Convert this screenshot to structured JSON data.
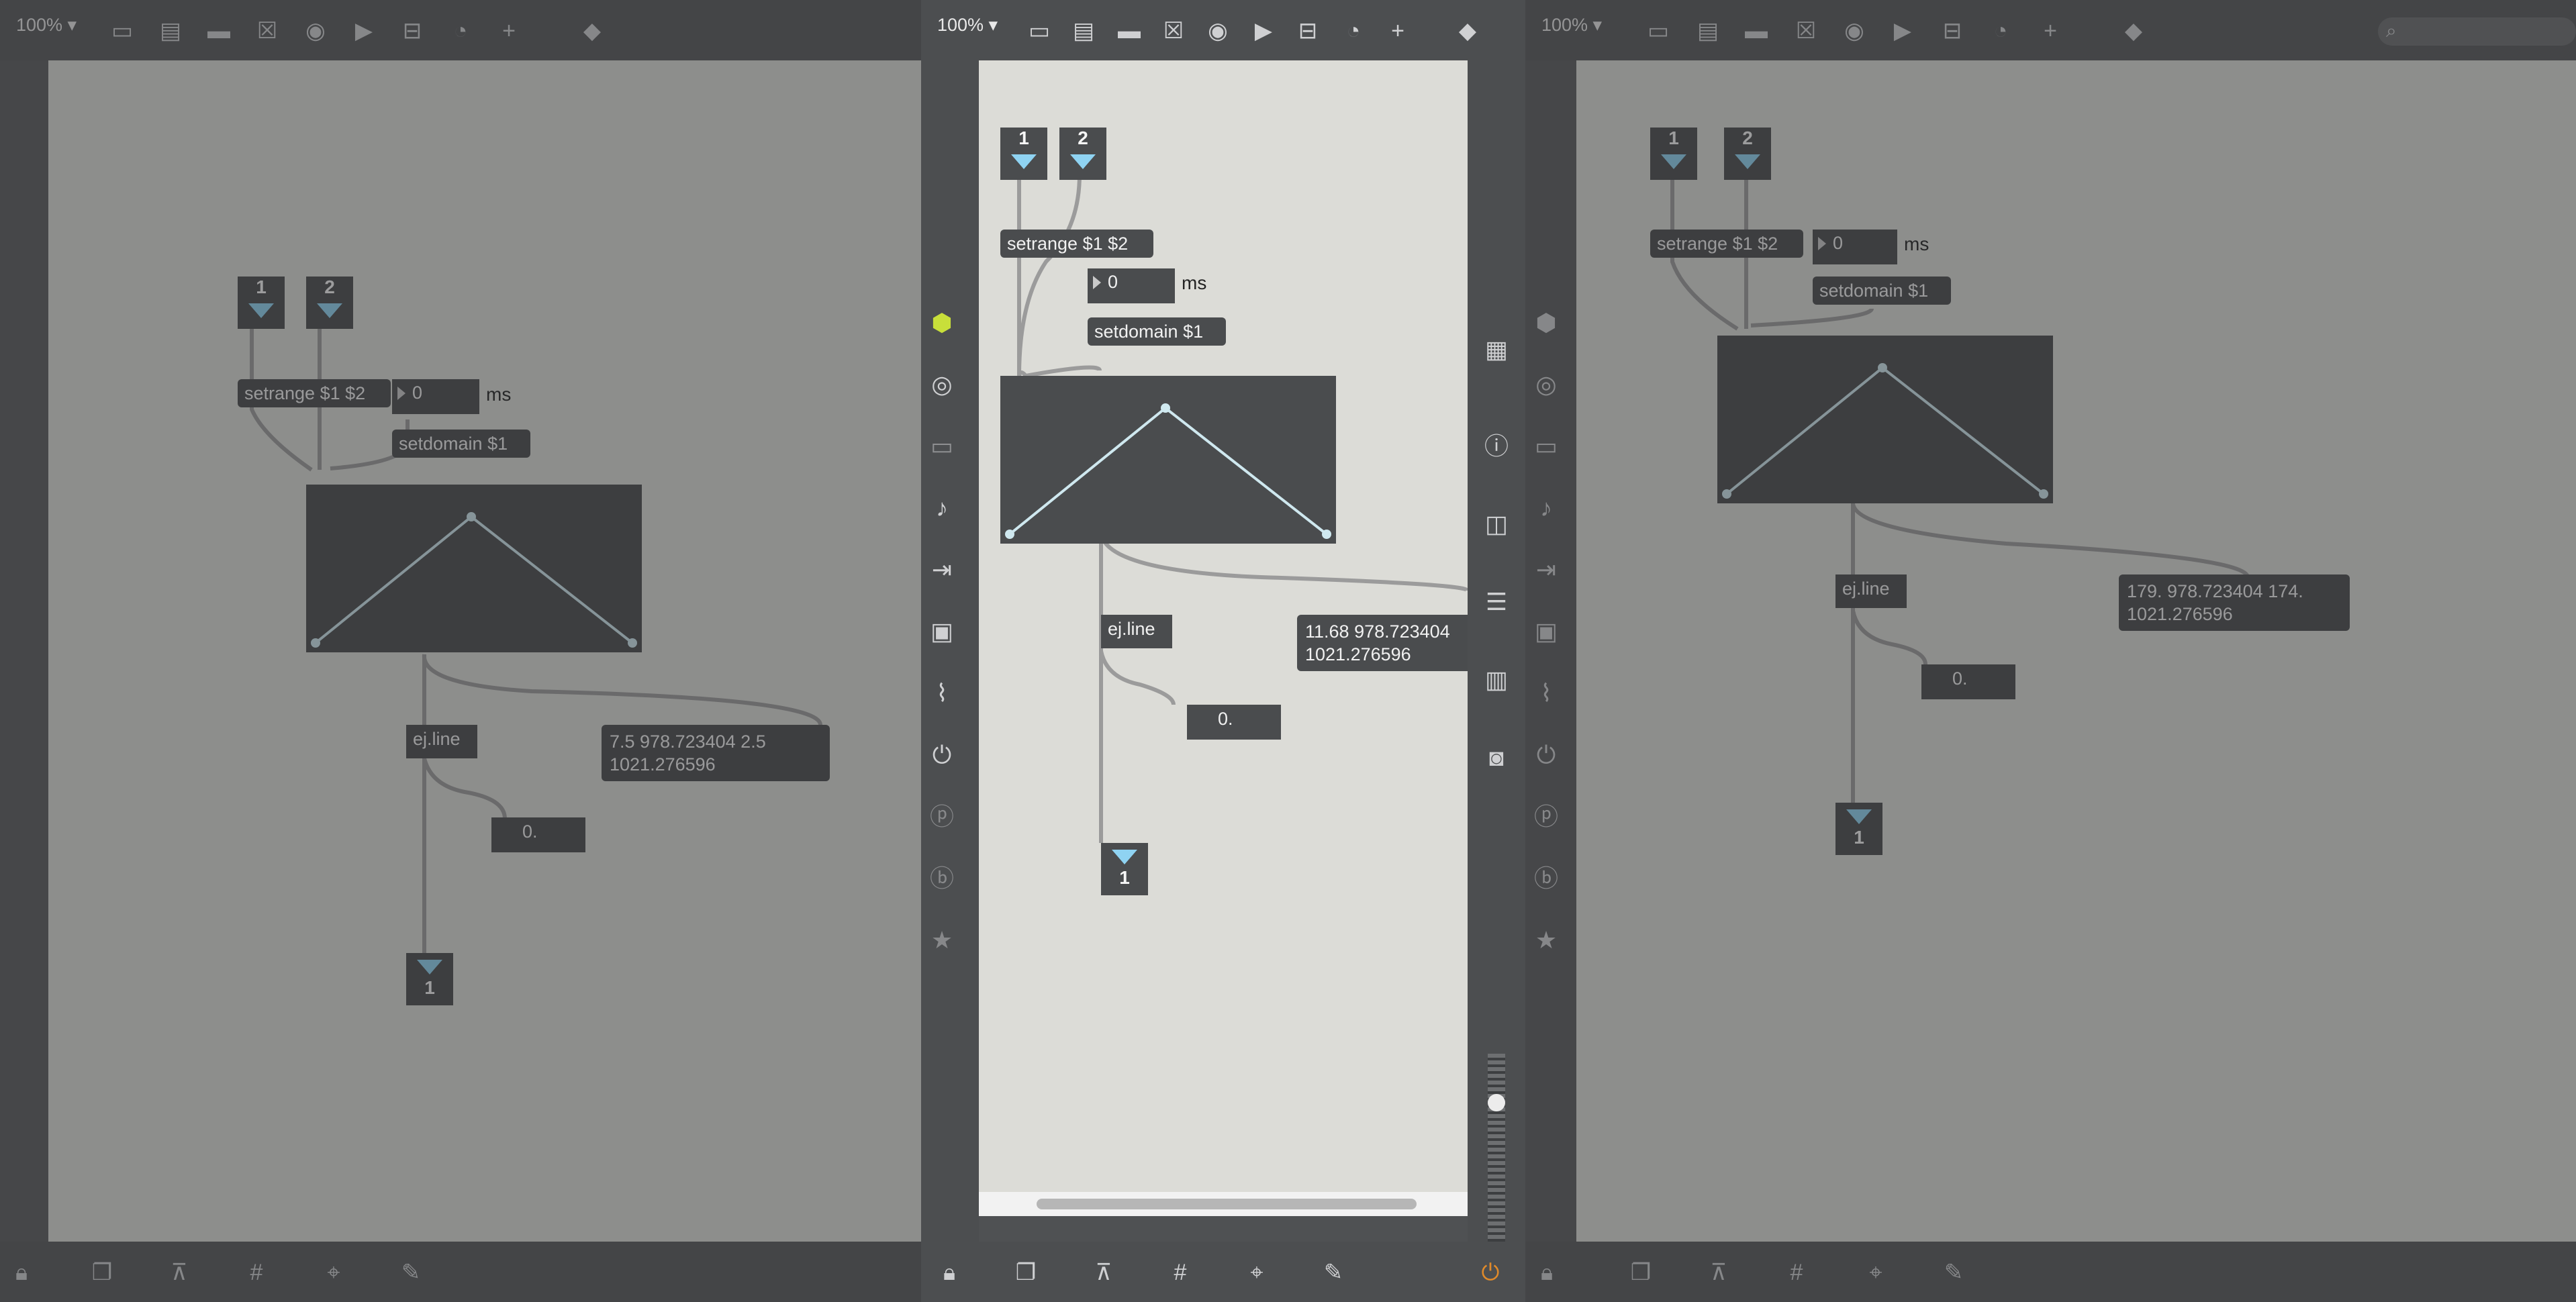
{
  "toolbar": {
    "zoom": "100% ▾"
  },
  "patch_left": {
    "inlet1": "1",
    "inlet2": "2",
    "setrange": "setrange $1 $2",
    "ms_value": "0",
    "ms_unit": "ms",
    "setdomain": "setdomain $1",
    "ejline": "ej.line",
    "message": "7.5 978.723404 2.5 1021.276596",
    "signal": "0.",
    "outlet": "1"
  },
  "patch_center": {
    "inlet1": "1",
    "inlet2": "2",
    "setrange": "setrange $1 $2",
    "ms_value": "0",
    "ms_unit": "ms",
    "setdomain": "setdomain $1",
    "ejline": "ej.line",
    "message": "11.68 978.723404 1021.276596",
    "signal": "0.",
    "outlet": "1"
  },
  "patch_right": {
    "inlet1": "1",
    "inlet2": "2",
    "setrange": "setrange $1 $2",
    "ms_value": "0",
    "ms_unit": "ms",
    "setdomain": "setdomain $1",
    "ejline": "ej.line",
    "message": "179. 978.723404 174. 1021.276596",
    "signal": "0.",
    "outlet": "1"
  },
  "icons": {
    "top": [
      "new-object-icon",
      "presentation-icon",
      "comment-icon",
      "toggle-icon",
      "button-icon",
      "play-icon",
      "slider-icon",
      "dial-icon",
      "add-icon",
      "paint-bucket-icon"
    ],
    "left_sidebar": [
      "cube-icon",
      "target-icon",
      "keyboard-icon",
      "music-note-icon",
      "sequence-icon",
      "image-icon",
      "paperclip-icon",
      "plug-icon",
      "p-badge-icon",
      "b-badge-icon",
      "star-icon"
    ],
    "right_sidebar": [
      "grid-keyboard-icon",
      "info-icon",
      "book-icon",
      "list-icon",
      "reference-icon",
      "camera-icon"
    ],
    "bottom": [
      "lock-icon",
      "windows-icon",
      "presentation-mode-icon",
      "grid-icon",
      "snap-icon",
      "wrench-icon",
      "power-icon"
    ]
  },
  "colors": {
    "accent_green": "#c8df3a",
    "power_orange": "#e08a2a",
    "inlet_blue": "#8fd3f2"
  }
}
